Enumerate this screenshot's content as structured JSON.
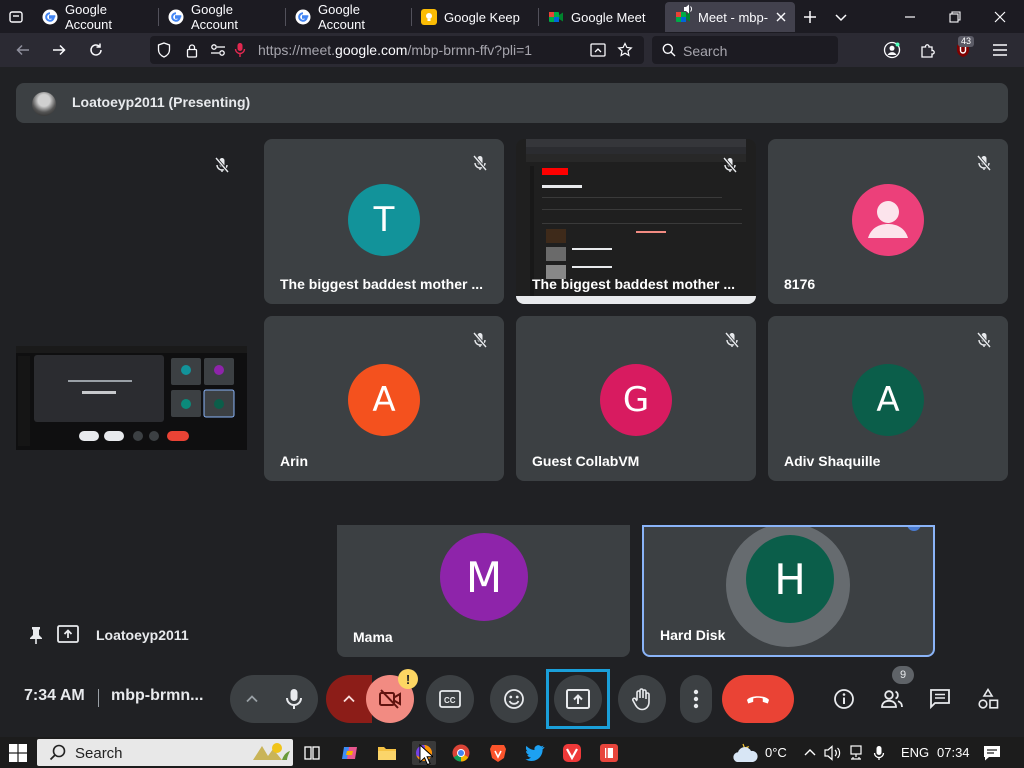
{
  "browser": {
    "tabs": [
      {
        "title": "Google Account"
      },
      {
        "title": "Google Account"
      },
      {
        "title": "Google Account"
      },
      {
        "title": "Google Keep"
      },
      {
        "title": "Google Meet"
      },
      {
        "title": "Meet - mbp-"
      }
    ],
    "url_scheme": "https://meet.",
    "url_domain": "google.com",
    "url_path": "/mbp-brmn-ffv?pli=1",
    "search_label": "Search",
    "extension_badge": "43"
  },
  "meet": {
    "presenter_banner": "Loatoeyp2011 (Presenting)",
    "tiles": [
      {
        "initial": "T",
        "name": "The biggest baddest mother ...",
        "color": "#12939a",
        "muted": true
      },
      {
        "initial": "",
        "name": "The biggest baddest mother ...",
        "screen_share": true,
        "muted": true
      },
      {
        "initial": "",
        "name": "8176",
        "color": "#ec407a",
        "generic_avatar": true,
        "muted": true
      },
      {
        "initial": "A",
        "name": "Arin",
        "color": "#f4511e",
        "muted": true
      },
      {
        "initial": "G",
        "name": "Guest CollabVM",
        "color": "#d81b60",
        "muted": true
      },
      {
        "initial": "A",
        "name": "Adiv Shaquille",
        "color": "#0b5e4a",
        "muted": true
      },
      {
        "initial": "M",
        "name": "Mama",
        "color": "#8e24aa",
        "muted": false
      },
      {
        "initial": "H",
        "name": "Hard Disk",
        "color": "#0b5e4a",
        "muted": false,
        "speaking": true
      }
    ],
    "pinned_name": "Loatoeyp2011",
    "clock": "7:34 AM",
    "meeting_code": "mbp-brmn...",
    "camera_warning": "!",
    "participant_count": "9",
    "colors": {
      "accent": "#8ab4f8",
      "end_call": "#ea4335",
      "share_highlight": "#1a9fd9",
      "camera_off": "#f28b82"
    }
  },
  "taskbar": {
    "search_label": "Search",
    "temperature": "0°C",
    "language": "ENG",
    "time": "07:34"
  }
}
